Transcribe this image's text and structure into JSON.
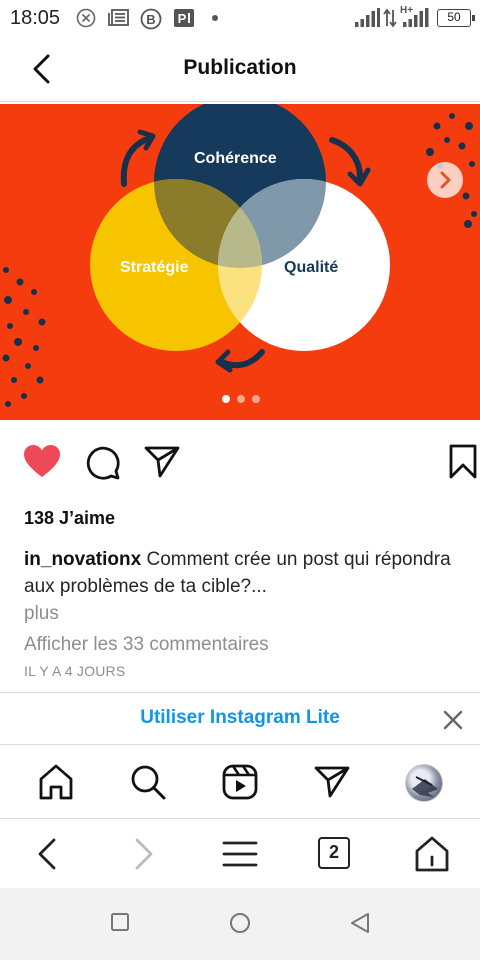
{
  "status_bar": {
    "time": "18:05",
    "battery": "50",
    "network": "H+"
  },
  "header": {
    "title": "Publication"
  },
  "post": {
    "circle_labels": {
      "top": "Cohérence",
      "left": "Stratégie",
      "right": "Qualité"
    },
    "carousel_pages": 3,
    "active_page": 1,
    "colors": {
      "background": "#f53c0f",
      "navy": "#153a5b",
      "yellow": "#f6c500",
      "white": "#ffffff",
      "like_red": "#ed4956",
      "link_blue": "#1095e8"
    }
  },
  "likes": "138 J’aime",
  "caption": {
    "username": "in_novationx",
    "text": "Comment crée un post qui répondra aux problèmes de ta cible?...",
    "more": "plus"
  },
  "comments_link": "Afficher les 33 commentaires",
  "time_ago": "IL Y A 4 JOURS",
  "lite_banner": {
    "text": "Utiliser Instagram Lite"
  },
  "tab_bar": {
    "items": [
      "home-icon",
      "search-icon",
      "reels-icon",
      "direct-icon",
      "profile-avatar"
    ]
  },
  "browser_bar": {
    "tab_count": "2",
    "items": [
      "back-icon",
      "forward-icon",
      "menu-icon",
      "tabs-icon",
      "home-icon"
    ]
  },
  "system_nav": {
    "items": [
      "recents-icon",
      "home-icon",
      "back-icon"
    ]
  }
}
